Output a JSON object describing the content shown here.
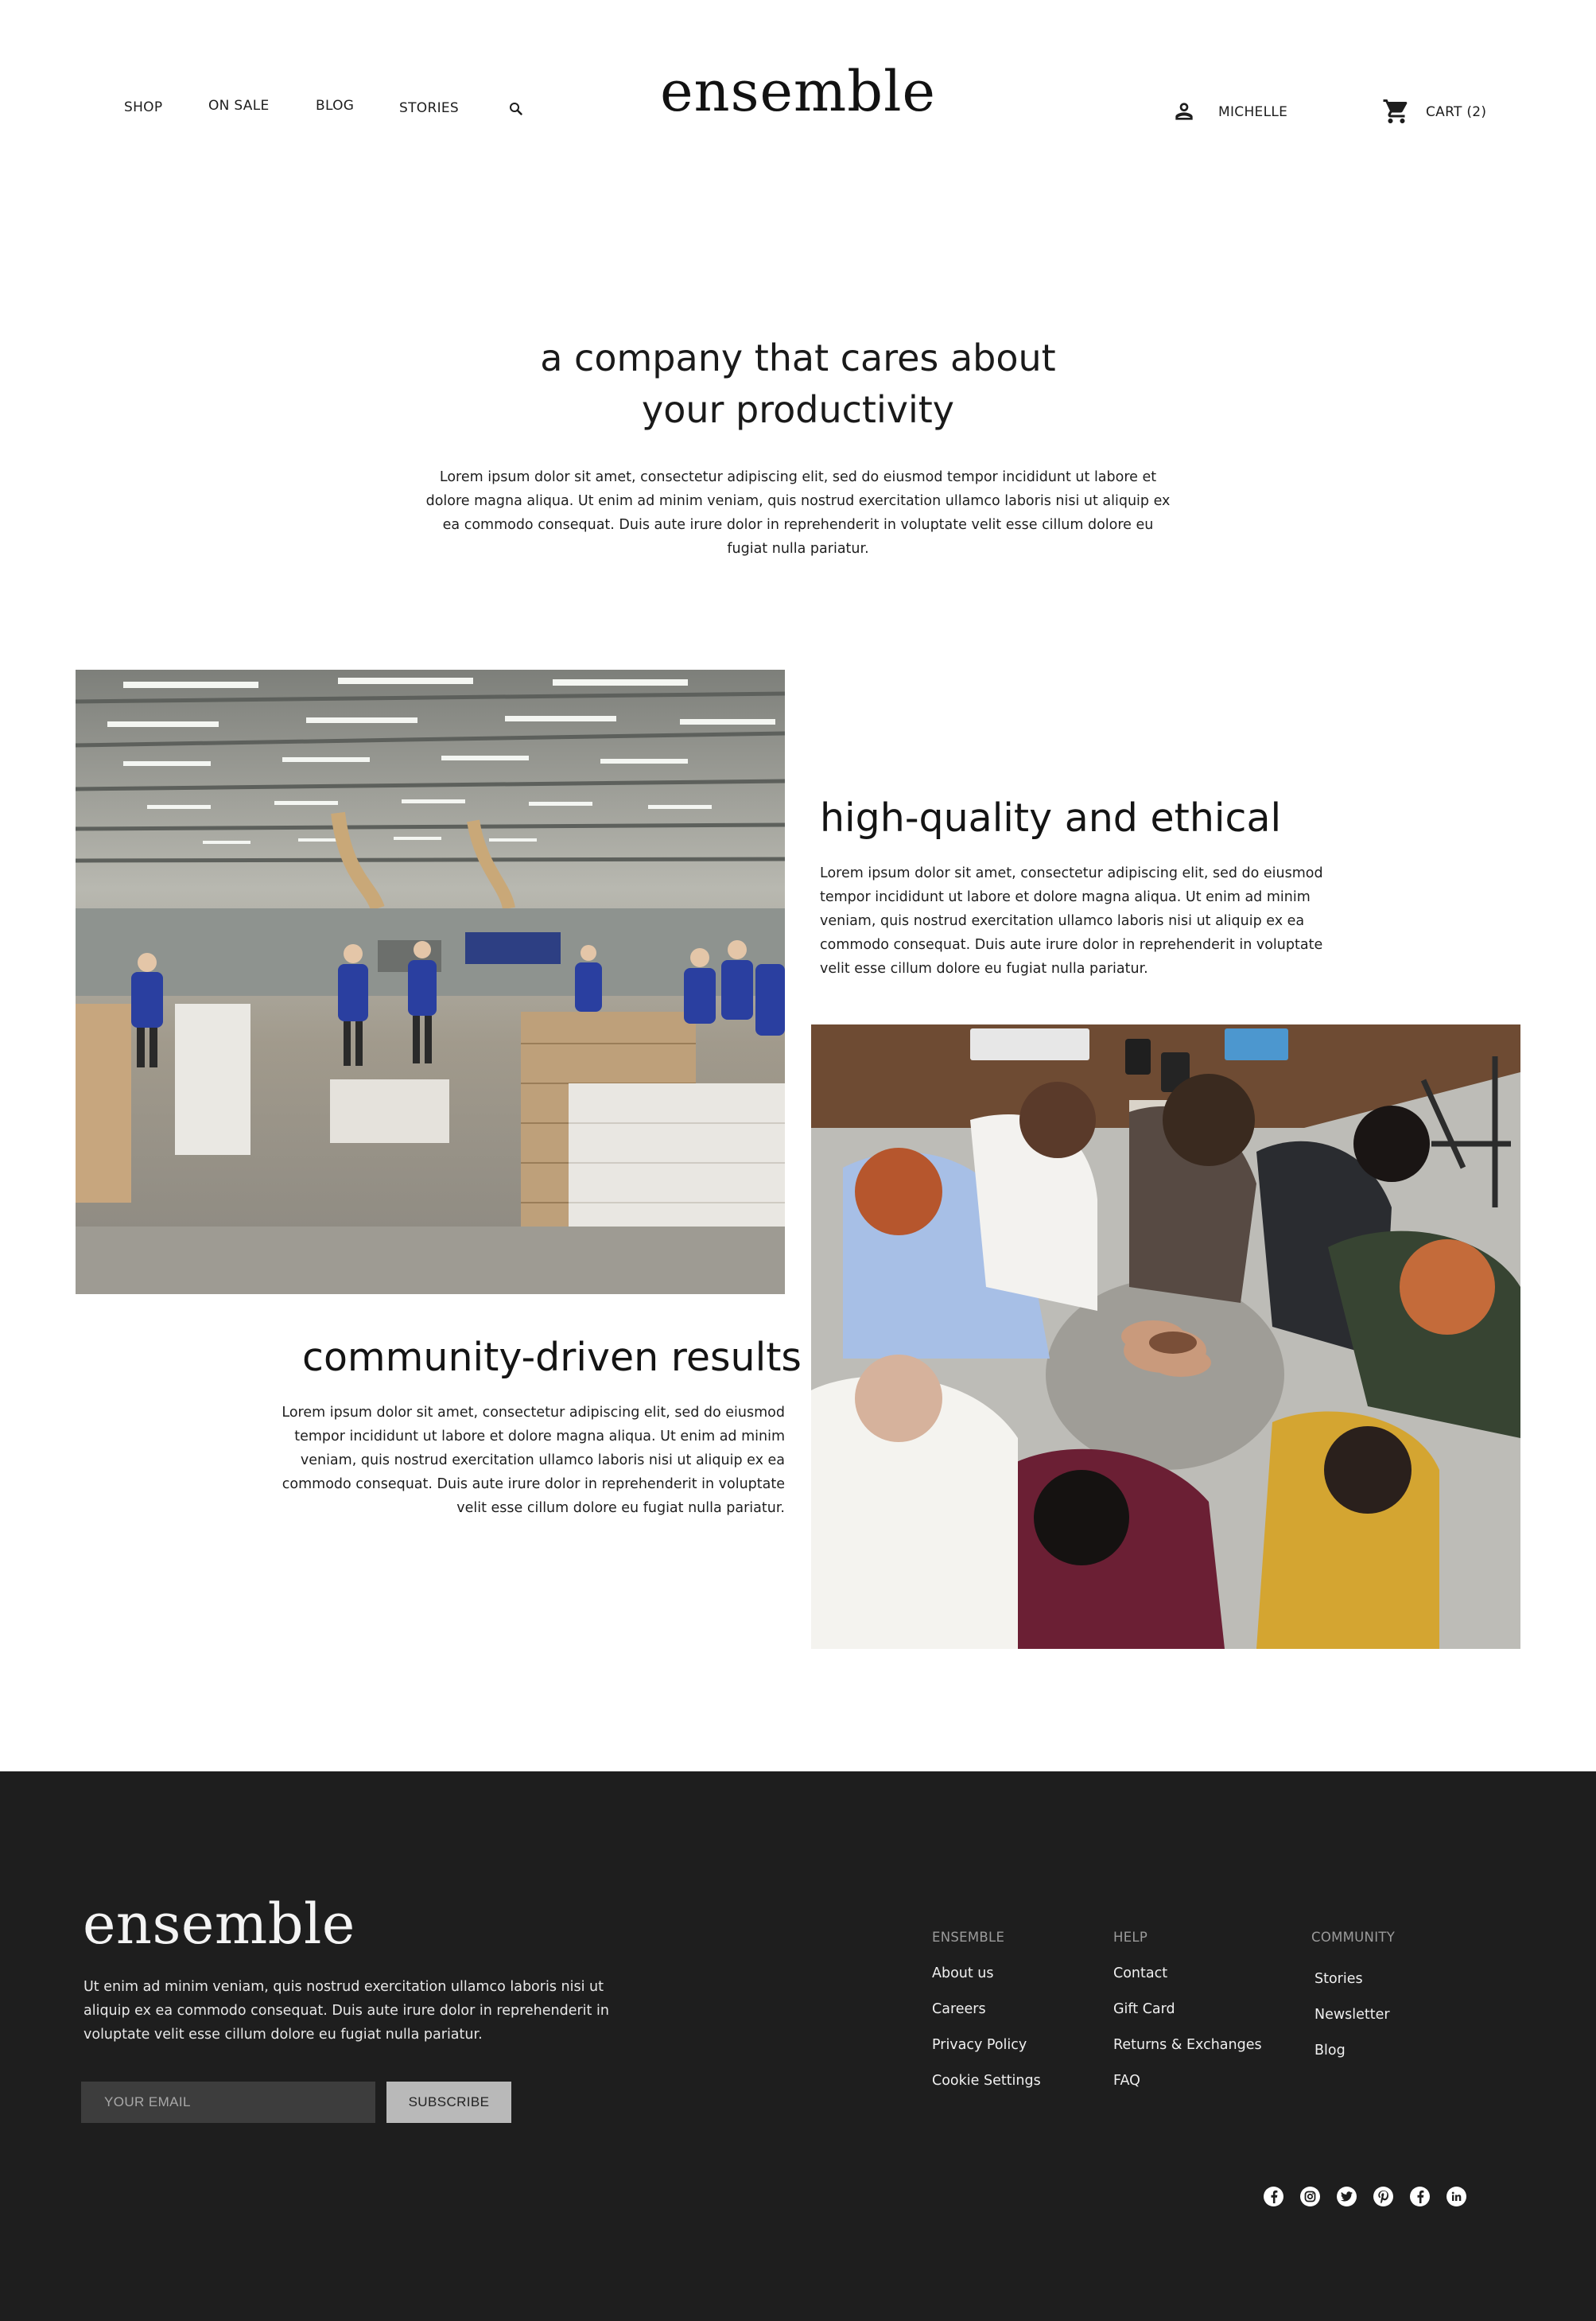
{
  "brand": "ensemble",
  "nav": {
    "links": [
      "SHOP",
      "ON SALE",
      "BLOG",
      "STORIES"
    ],
    "user_label": "MICHELLE",
    "cart_label": "CART (2)"
  },
  "intro": {
    "title_line1": "a company that cares about",
    "title_line2": "your productivity",
    "text": "Lorem ipsum dolor sit amet, consectetur adipiscing elit, sed do eiusmod tempor incididunt ut labore et dolore magna aliqua. Ut enim ad minim veniam, quis nostrud exercitation ullamco laboris nisi ut aliquip ex ea commodo consequat. Duis aute irure dolor in reprehenderit in voluptate velit esse cillum dolore eu fugiat nulla pariatur."
  },
  "features": [
    {
      "title": "high-quality and ethical",
      "text": "Lorem ipsum dolor sit amet, consectetur adipiscing elit, sed do eiusmod tempor incididunt ut labore et dolore magna aliqua. Ut enim ad minim veniam, quis nostrud exercitation ullamco laboris nisi ut aliquip ex ea commodo consequat. Duis aute irure dolor in reprehenderit in voluptate velit esse cillum dolore eu fugiat nulla pariatur."
    },
    {
      "title": "community-driven results",
      "text": "Lorem ipsum dolor sit amet, consectetur adipiscing elit, sed do eiusmod tempor incididunt ut labore et dolore magna aliqua. Ut enim ad minim veniam, quis nostrud exercitation ullamco laboris nisi ut aliquip ex ea commodo consequat. Duis aute irure dolor in reprehenderit in voluptate velit esse cillum dolore eu fugiat nulla pariatur."
    }
  ],
  "footer": {
    "logo": "ensemble",
    "text": "Ut enim ad minim veniam, quis nostrud exercitation ullamco laboris nisi ut aliquip ex ea commodo consequat. Duis aute irure dolor in reprehenderit in voluptate velit esse cillum dolore eu fugiat nulla pariatur.",
    "email_placeholder": "YOUR EMAIL",
    "subscribe_label": "SUBSCRIBE",
    "columns": [
      {
        "heading": "ENSEMBLE",
        "links": [
          "About us",
          "Careers",
          "Privacy Policy",
          "Cookie Settings"
        ]
      },
      {
        "heading": "HELP",
        "links": [
          "Contact",
          "Gift Card",
          "Returns & Exchanges",
          "FAQ"
        ]
      },
      {
        "heading": "COMMUNITY",
        "links": [
          "Stories",
          "Newsletter",
          "Blog"
        ]
      }
    ],
    "social_icons": [
      "facebook-icon",
      "instagram-icon",
      "twitter-icon",
      "pinterest-icon",
      "facebook-icon",
      "linkedin-icon"
    ]
  },
  "colors": {
    "footer_bg": "#1e1e1e",
    "input_bg": "#3d3d3d",
    "button_bg": "#b9b9b9",
    "text": "#1b1b1b"
  }
}
